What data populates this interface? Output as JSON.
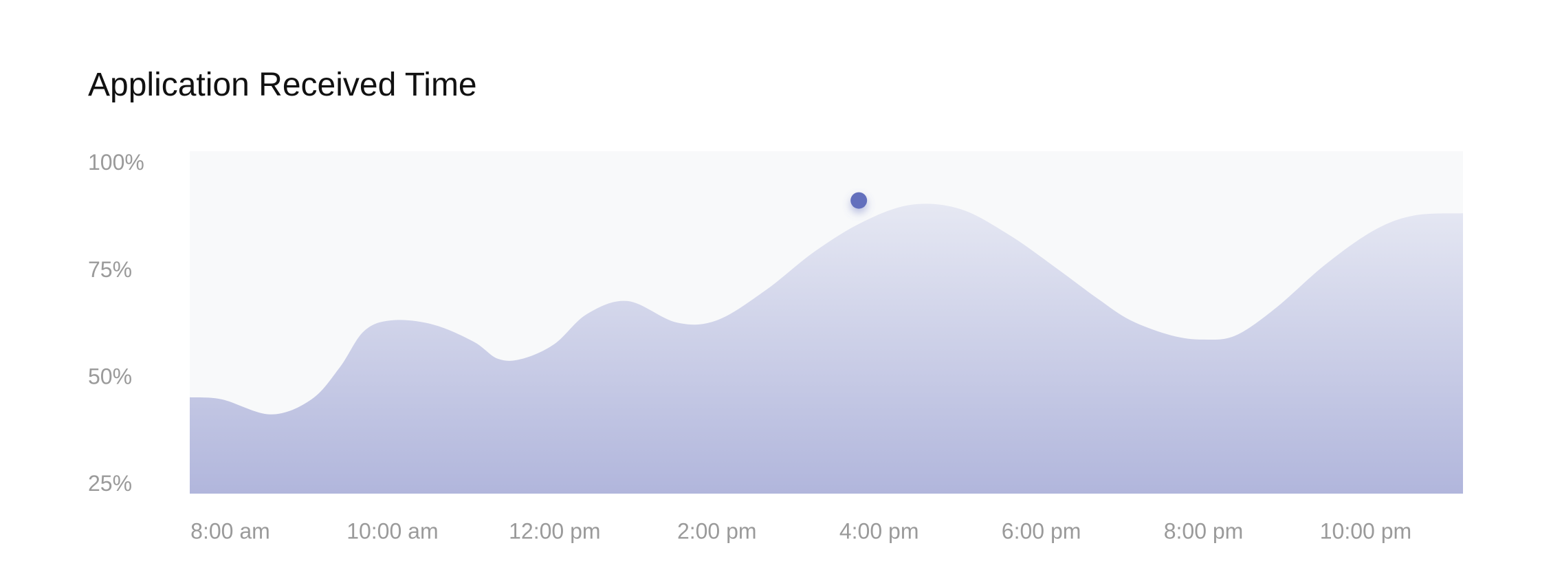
{
  "title": "Application Received Time",
  "colors": {
    "plot_background": "#f8f9fa",
    "area_top": "#e6e8f3",
    "area_bottom": "#b1b6dc",
    "marker": "#6470bd",
    "tick_text": "#9a9a9a",
    "title_text": "#111111"
  },
  "chart_data": {
    "type": "area",
    "title": "Application Received Time",
    "xlabel": "",
    "ylabel": "",
    "x_tick_labels": [
      "8:00 am",
      "10:00 am",
      "12:00 pm",
      "2:00 pm",
      "4:00 pm",
      "6:00 pm",
      "8:00 pm",
      "10:00 pm"
    ],
    "y_tick_labels": [
      "100%",
      "75%",
      "50%",
      "25%"
    ],
    "y_ticks": [
      100,
      75,
      50,
      25
    ],
    "ylim": [
      23,
      103
    ],
    "xlim": [
      7.5,
      23.2
    ],
    "x_unit": "hour of day",
    "grid": false,
    "legend": "none",
    "series": [
      {
        "x": [
          7.5,
          7.9,
          8.5,
          9.0,
          9.35,
          9.65,
          10.0,
          10.5,
          11.0,
          11.3,
          11.6,
          12.0,
          12.4,
          12.9,
          13.5,
          14.0,
          14.6,
          15.2,
          15.8,
          16.4,
          17.0,
          17.6,
          18.2,
          18.7,
          19.1,
          19.6,
          20.0,
          20.4,
          20.9,
          21.5,
          22.1,
          22.6,
          23.2
        ],
        "y": [
          45.5,
          45.0,
          41.5,
          45.0,
          52.5,
          61.0,
          63.5,
          62.5,
          58.5,
          54.5,
          54.5,
          58.0,
          65.0,
          68.0,
          63.0,
          63.5,
          70.5,
          79.5,
          86.5,
          90.5,
          89.5,
          83.5,
          75.5,
          68.5,
          63.5,
          60.0,
          59.0,
          60.0,
          66.5,
          76.5,
          84.5,
          88.0,
          88.5
        ]
      }
    ],
    "highlight_point": {
      "x": 15.75,
      "y": 91.5
    }
  }
}
